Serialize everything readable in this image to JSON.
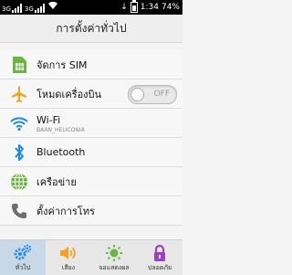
{
  "status_bar": {
    "signal_labels": [
      "3G",
      "3G"
    ],
    "time": "1:34",
    "battery": "74%",
    "battery_level": 0.74
  },
  "header": {
    "title": "การตั้งค่าทั่วไป"
  },
  "list": [
    {
      "label": "จัดการ SIM",
      "icon": "sim-card-icon"
    },
    {
      "label": "โหมดเครื่องบิน",
      "icon": "airplane-icon",
      "toggle": "OFF"
    },
    {
      "label": "Wi-Fi",
      "sublabel": "BAAN_HELICONIA",
      "icon": "wifi-icon"
    },
    {
      "label": "Bluetooth",
      "icon": "bluetooth-icon"
    },
    {
      "label": "เครือข่าย",
      "icon": "globe-icon"
    },
    {
      "label": "ตั้งค่าการโทร",
      "icon": "phone-icon"
    }
  ],
  "tabs": [
    {
      "label": "ทั่วไป",
      "icon": "gears-icon",
      "active": true
    },
    {
      "label": "เสียง",
      "icon": "speaker-icon"
    },
    {
      "label": "จอแสดงผล",
      "icon": "brightness-icon"
    },
    {
      "label": "ปลอดภัย",
      "icon": "lock-icon"
    }
  ],
  "colors": {
    "accent_blue": "#1e88e5",
    "sim_green": "#6ab544",
    "airplane_orange": "#f5a020",
    "tab_active_bg": "#c9d8e6"
  }
}
